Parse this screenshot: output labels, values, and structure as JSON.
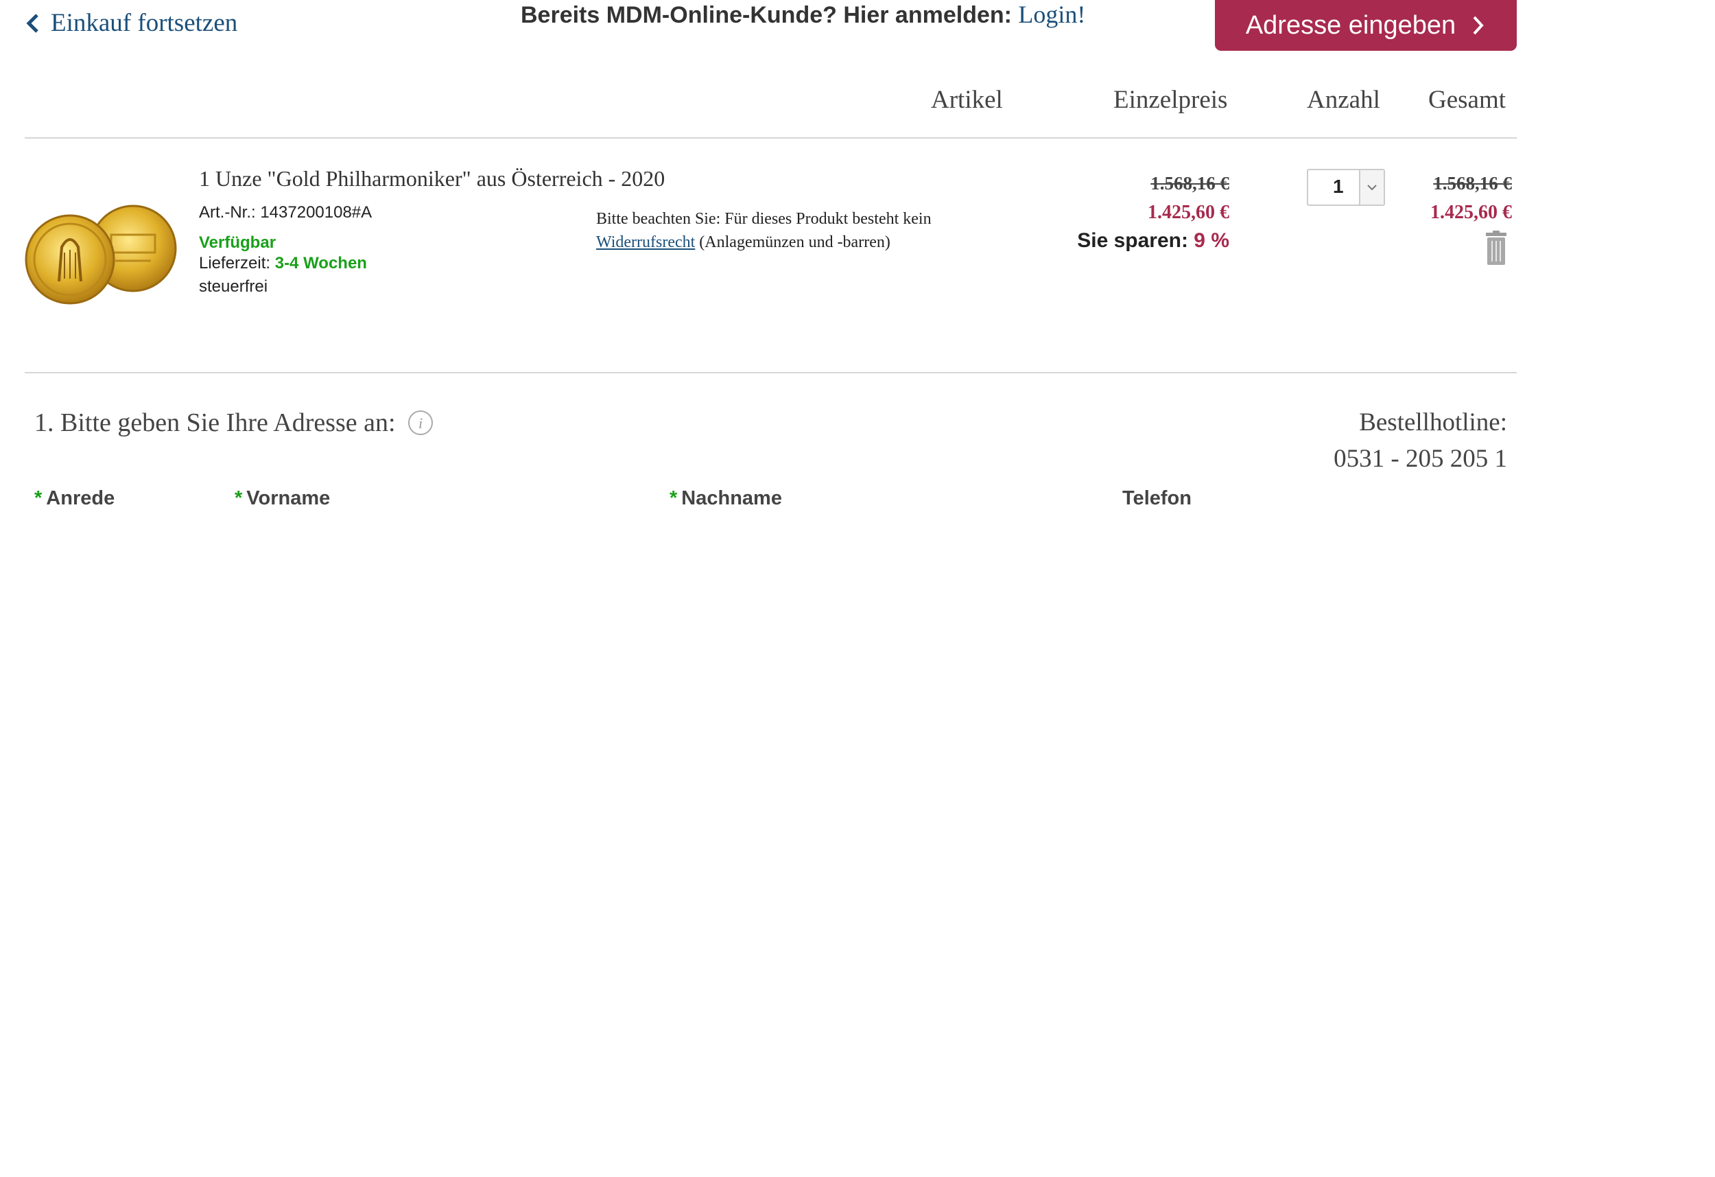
{
  "header": {
    "back_label": "Einkauf fortsetzen",
    "login_prompt": "Bereits MDM-Online-Kunde? Hier anmelden: ",
    "login_link": "Login!",
    "cta_label": "Adresse eingeben"
  },
  "columns": {
    "article": "Artikel",
    "unit_price": "Einzelpreis",
    "quantity": "Anzahl",
    "total": "Gesamt"
  },
  "product": {
    "title": "1 Unze \"Gold Philharmoniker\" aus Österreich - 2020",
    "art_nr": "Art.-Nr.: 1437200108#A",
    "availability": "Verfügbar",
    "delivery_label": "Lieferzeit: ",
    "delivery_time": "3-4 Wochen",
    "tax": "steuerfrei",
    "notice_text": "Bitte beachten Sie: Für dieses Produkt besteht kein",
    "notice_link": "Widerrufsrecht",
    "notice_suffix": " (Anlagemünzen und -barren)",
    "unit_price_old": "1.568,16 €",
    "unit_price_new": "1.425,60 €",
    "savings_label": "Sie sparen: ",
    "savings_pct": "9 %",
    "quantity": "1",
    "total_old": "1.568,16 €",
    "total_new": "1.425,60 €"
  },
  "address": {
    "heading": "1. Bitte geben Sie Ihre Adresse an:",
    "hotline_label": "Bestellhotline:",
    "hotline_number": "0531 - 205 205 1",
    "required_marker": "*",
    "fields": {
      "salutation": "Anrede",
      "first_name": "Vorname",
      "last_name": "Nachname",
      "phone": "Telefon"
    }
  },
  "colors": {
    "accent": "#a82a4e",
    "link": "#1b4f7a",
    "available": "#1aa01a"
  },
  "icons": [
    "chevron-left-icon",
    "chevron-right-icon",
    "chevron-down-icon",
    "trash-icon",
    "info-icon"
  ]
}
